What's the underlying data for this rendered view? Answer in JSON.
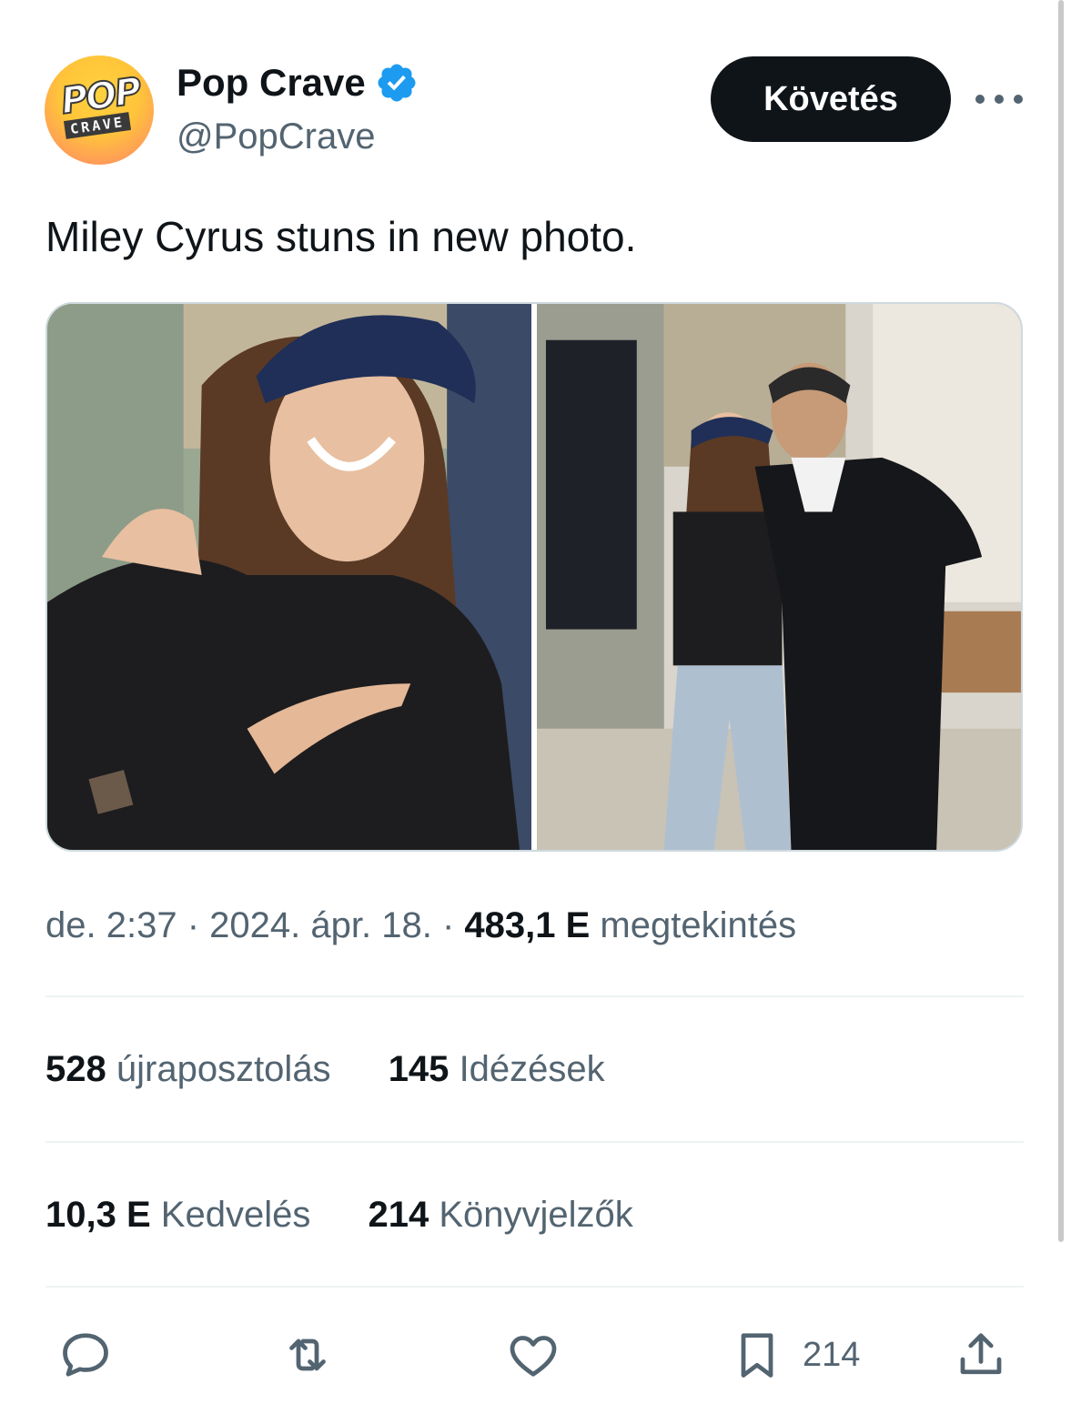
{
  "author": {
    "name": "Pop Crave",
    "handle": "@PopCrave",
    "avatar_logo_top": "POP",
    "avatar_logo_bottom": "CRAVE",
    "verified_color": "#1d9bf0"
  },
  "follow_label": "Követés",
  "tweet_text": "Miley Cyrus stuns in new photo.",
  "meta": {
    "time": "de. 2:37",
    "separator": "·",
    "date": "2024. ápr. 18.",
    "views_count": "483,1 E",
    "views_label": "megtekintés"
  },
  "stats": {
    "reposts_count": "528",
    "reposts_label": "újraposztolás",
    "quotes_count": "145",
    "quotes_label": "Idézések",
    "likes_count": "10,3 E",
    "likes_label": "Kedvelés",
    "bookmarks_count": "214",
    "bookmarks_label": "Könyvjelzők"
  },
  "actions": {
    "bookmark_count": "214"
  },
  "colors": {
    "text_primary": "#0f1419",
    "text_secondary": "#536471",
    "divider": "#eff3f4"
  }
}
